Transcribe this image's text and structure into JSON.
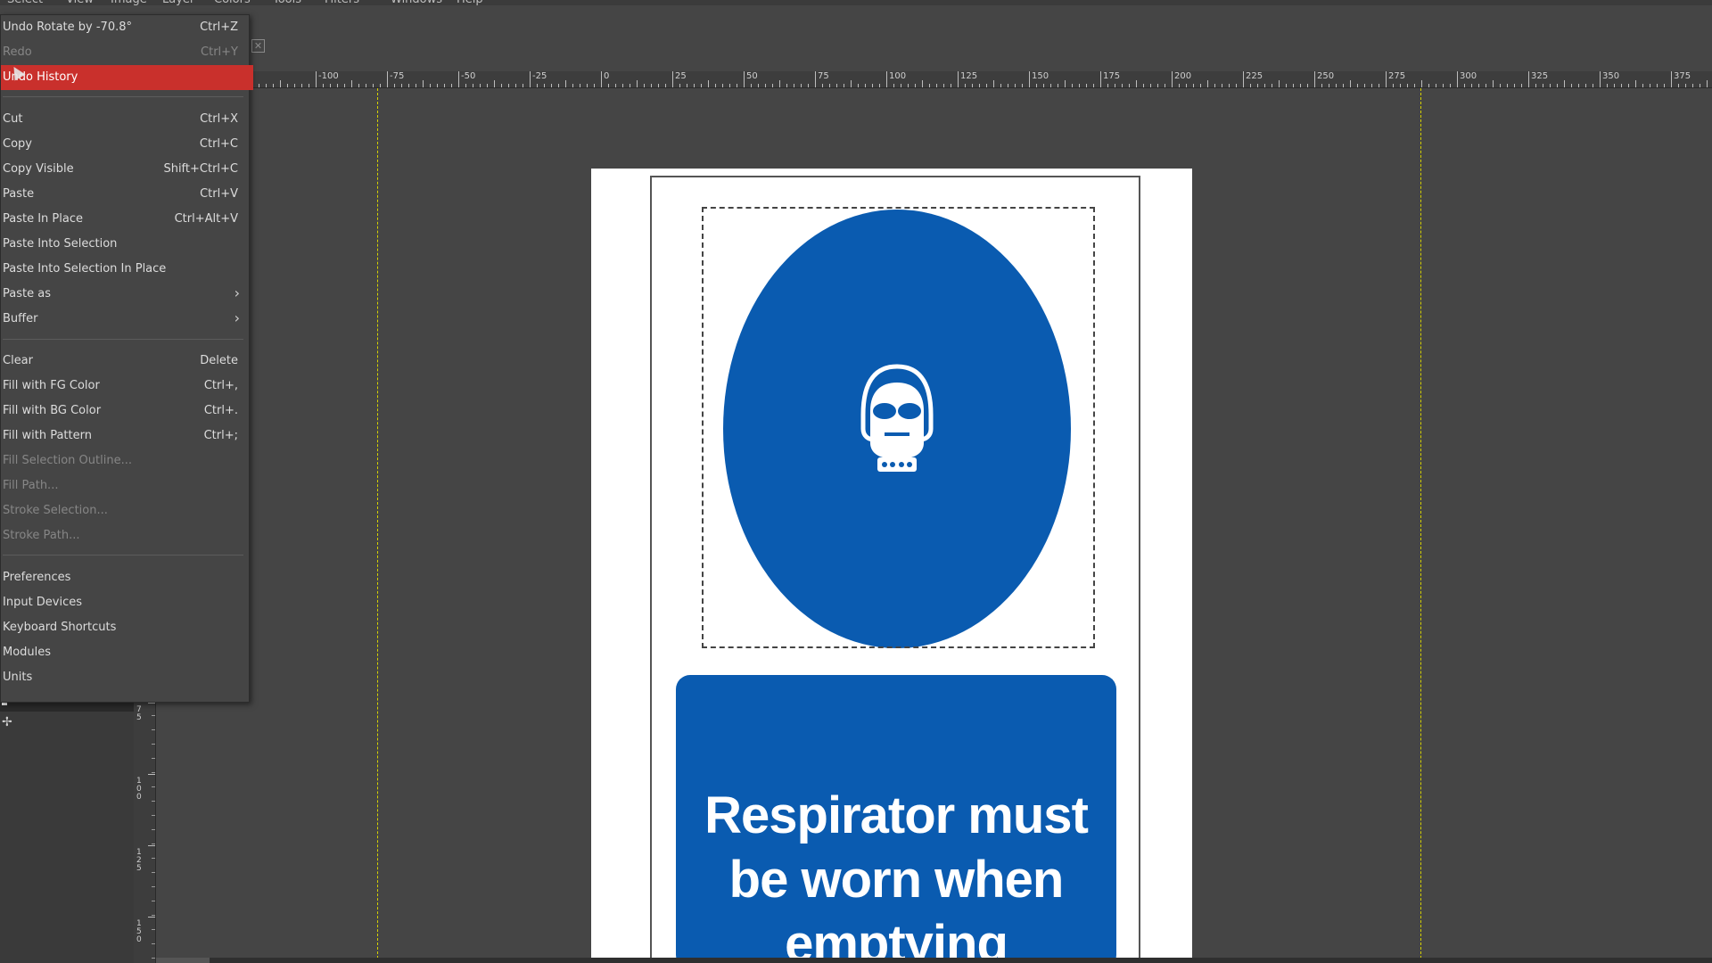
{
  "menubar": {
    "items": [
      "Select",
      "View",
      "Image",
      "Layer",
      "Colors",
      "Tools",
      "Filters",
      "Windows",
      "Help"
    ]
  },
  "ruler_horizontal": [
    "-100",
    "-75",
    "-50",
    "-25",
    "0",
    "25",
    "50",
    "75",
    "100",
    "125",
    "150",
    "175",
    "200",
    "225",
    "250",
    "275",
    "300",
    "325",
    "350",
    "375"
  ],
  "ruler_vertical": [
    "75",
    "100",
    "125",
    "150"
  ],
  "edit_menu": {
    "undo": {
      "label": "Undo Rotate by -70.8°",
      "shortcut": "Ctrl+Z"
    },
    "redo": {
      "label": "Redo",
      "shortcut": "Ctrl+Y"
    },
    "undo_history": {
      "label": "Undo History"
    },
    "cut": {
      "label": "Cut",
      "shortcut": "Ctrl+X"
    },
    "copy": {
      "label": "Copy",
      "shortcut": "Ctrl+C"
    },
    "copy_visible": {
      "label": "Copy Visible",
      "shortcut": "Shift+Ctrl+C"
    },
    "paste": {
      "label": "Paste",
      "shortcut": "Ctrl+V"
    },
    "paste_in_place": {
      "label": "Paste In Place",
      "shortcut": "Ctrl+Alt+V"
    },
    "paste_into_selection": {
      "label": "Paste Into Selection"
    },
    "paste_into_selection_in_place": {
      "label": "Paste Into Selection In Place"
    },
    "paste_as": {
      "label": "Paste as"
    },
    "buffer": {
      "label": "Buffer"
    },
    "clear": {
      "label": "Clear",
      "shortcut": "Delete"
    },
    "fill_fg": {
      "label": "Fill with FG Color",
      "shortcut": "Ctrl+,"
    },
    "fill_bg": {
      "label": "Fill with BG Color",
      "shortcut": "Ctrl+."
    },
    "fill_pattern": {
      "label": "Fill with Pattern",
      "shortcut": "Ctrl+;"
    },
    "fill_selection_outline": {
      "label": "Fill Selection Outline..."
    },
    "fill_path": {
      "label": "Fill Path..."
    },
    "stroke_selection": {
      "label": "Stroke Selection..."
    },
    "stroke_path": {
      "label": "Stroke Path..."
    },
    "preferences": {
      "label": "Preferences"
    },
    "input_devices": {
      "label": "Input Devices"
    },
    "keyboard_shortcuts": {
      "label": "Keyboard Shortcuts"
    },
    "modules": {
      "label": "Modules"
    },
    "units": {
      "label": "Units"
    }
  },
  "image": {
    "sign_text": "Respirator must be worn when emptying"
  },
  "colors": {
    "menu_highlight": "#c9302c",
    "sign_blue": "#0a5bb0",
    "guide": "#d6d200"
  }
}
